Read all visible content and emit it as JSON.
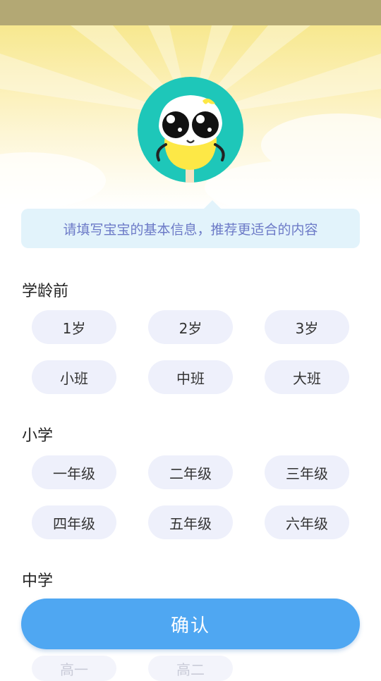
{
  "tooltip": {
    "text": "请填写宝宝的基本信息，推荐更适合的内容"
  },
  "sections": {
    "preschool": {
      "title": "学龄前",
      "options": [
        "1岁",
        "2岁",
        "3岁",
        "小班",
        "中班",
        "大班"
      ]
    },
    "primary": {
      "title": "小学",
      "options": [
        "一年级",
        "二年级",
        "三年级",
        "四年级",
        "五年级",
        "六年级"
      ]
    },
    "middle": {
      "title": "中学",
      "options": [
        "高一",
        "高二"
      ]
    }
  },
  "confirm_label": "确认",
  "colors": {
    "primary_button": "#4fa7f2",
    "chip_bg": "#eef0fb",
    "tooltip_bg": "#e2f3fb",
    "tooltip_text": "#6c7ac7",
    "mascot_circle": "#1ec7b9",
    "mascot_body": "#fde846"
  },
  "icons": {
    "mascot": "yellow-egg-mascot-avatar"
  }
}
